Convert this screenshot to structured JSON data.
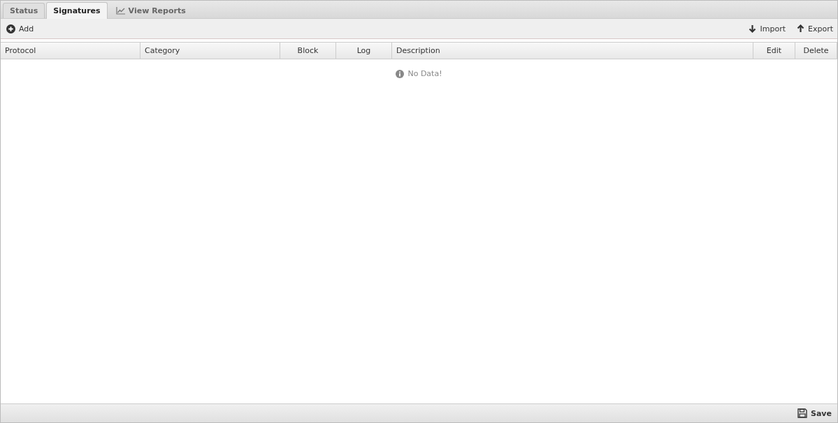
{
  "tabs": [
    {
      "label": "Status",
      "selected": false,
      "kind": "tab"
    },
    {
      "label": "Signatures",
      "selected": true,
      "kind": "tab"
    },
    {
      "label": "View Reports",
      "selected": false,
      "kind": "report"
    }
  ],
  "toolbar": {
    "left": [
      {
        "label": "Add",
        "kind": "add"
      }
    ],
    "right": [
      {
        "label": "Import",
        "kind": "import"
      },
      {
        "label": "Export",
        "kind": "export"
      }
    ]
  },
  "table": {
    "columns": [
      "Protocol",
      "Category",
      "Block",
      "Log",
      "Description",
      "Edit",
      "Delete"
    ],
    "empty_message": "No Data!"
  },
  "footer": {
    "buttons": [
      {
        "label": "Save",
        "kind": "save"
      }
    ]
  }
}
